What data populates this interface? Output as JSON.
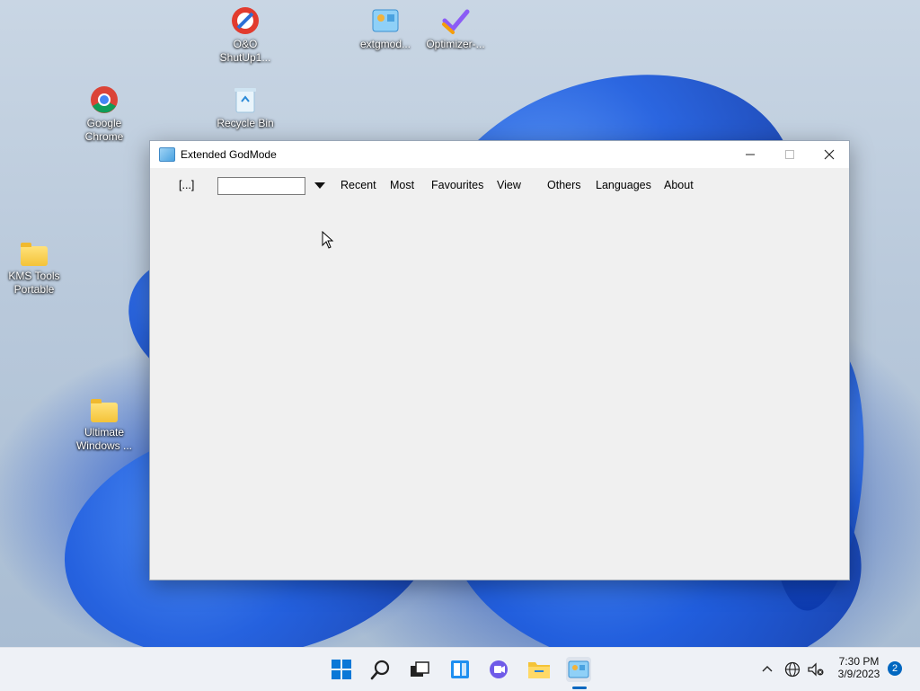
{
  "desktop": {
    "icons": [
      {
        "label": "O&O ShutUp1..."
      },
      {
        "label": "extgmod..."
      },
      {
        "label": "Optimizer-..."
      },
      {
        "label": "Google Chrome"
      },
      {
        "label": "Recycle Bin"
      },
      {
        "label": "KMS Tools Portable"
      },
      {
        "label": "Ultimate Windows ..."
      }
    ]
  },
  "window": {
    "title": "Extended GodMode",
    "menu": {
      "dots": "[...]",
      "search_value": "",
      "items": [
        "Recent",
        "Most",
        "Favourites",
        "View",
        "Others",
        "Languages",
        "About"
      ]
    }
  },
  "taskbar": {
    "clock_time": "7:30 PM",
    "clock_date": "3/9/2023",
    "notification_count": "2"
  },
  "colors": {
    "accent": "#0067c0",
    "window_bg": "#f0f0f0",
    "taskbar_bg": "#eef1f6"
  }
}
